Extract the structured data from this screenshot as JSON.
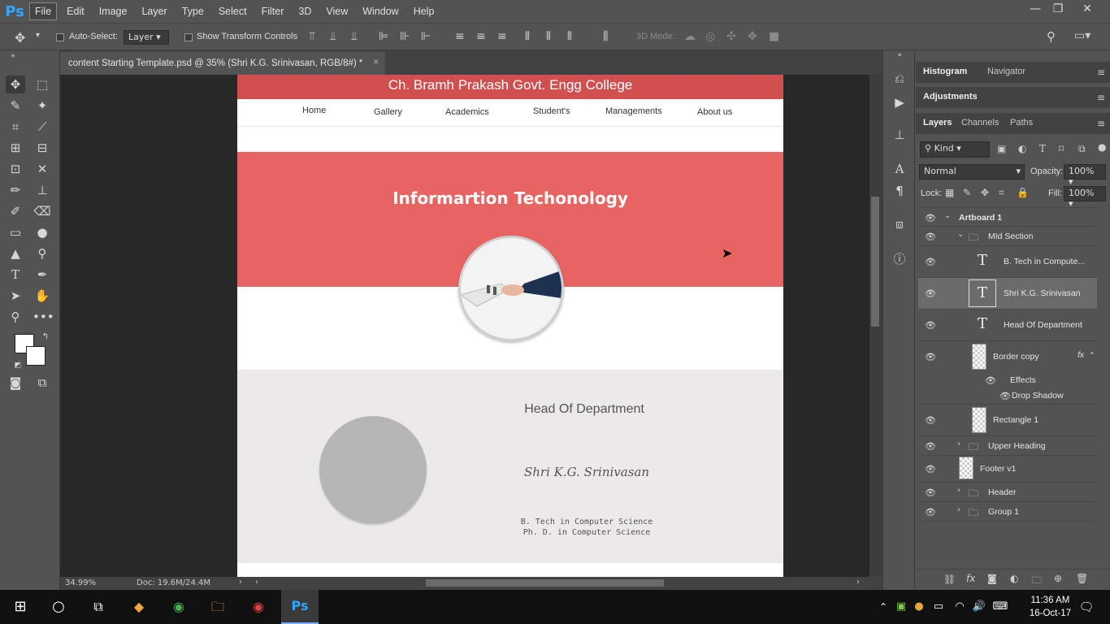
{
  "app": {
    "logo": "Ps"
  },
  "menu": [
    "File",
    "Edit",
    "Image",
    "Layer",
    "Type",
    "Select",
    "Filter",
    "3D",
    "View",
    "Window",
    "Help"
  ],
  "window_controls": {
    "minimize": "—",
    "restore": "❐",
    "close": "✕"
  },
  "options": {
    "auto_select_label": "Auto-Select:",
    "auto_select_target": "Layer",
    "show_transform_label": "Show Transform Controls",
    "mode_3d_label": "3D Mode:"
  },
  "document": {
    "tab_title": "content Starting Template.psd @ 35% (Shri  K.G. Srinivasan, RGB/8#) *",
    "close": "×",
    "zoom": "34.99%",
    "doc_size": "Doc: 19.6M/24.4M"
  },
  "artboard": {
    "college_name": "Ch. Bramh Prakash Govt. Engg College",
    "nav": [
      "Home",
      "Gallery",
      "Academics",
      "Student's",
      "Managements",
      "About us"
    ],
    "section_title": "Informartion Techonology",
    "hod_heading": "Head Of Department",
    "hod_name": "Shri  K.G. Srinivasan",
    "hod_qual_1": "B. Tech in Computer Science",
    "hod_qual_2": "Ph. D. in Computer Science"
  },
  "panels": {
    "top_tabs": [
      "Histogram",
      "Navigator"
    ],
    "adjustments": "Adjustments",
    "layer_tabs": [
      "Layers",
      "Channels",
      "Paths"
    ],
    "kind": "Kind",
    "blend_mode": "Normal",
    "opacity_label": "Opacity:",
    "opacity": "100%",
    "lock_label": "Lock:",
    "fill_label": "Fill:",
    "fill": "100%"
  },
  "layers": [
    {
      "name": "Artboard 1"
    },
    {
      "name": "MId Section"
    },
    {
      "name": "B. Tech in Compute..."
    },
    {
      "name": "Shri  K.G. Srinivasan"
    },
    {
      "name": "Head Of Department"
    },
    {
      "name": "Border copy"
    },
    {
      "name": "Effects"
    },
    {
      "name": "Drop Shadow"
    },
    {
      "name": "Rectangle 1"
    },
    {
      "name": "Upper Heading"
    },
    {
      "name": "Footer v1"
    },
    {
      "name": "Header"
    },
    {
      "name": "Group 1"
    }
  ],
  "fx_label": "fx",
  "taskbar": {
    "time": "11:36 AM",
    "date": "16-Oct-17"
  },
  "colors": {
    "brand_red": "#e86462",
    "header_red": "#d24f4f",
    "ps_blue": "#31a8ff"
  }
}
